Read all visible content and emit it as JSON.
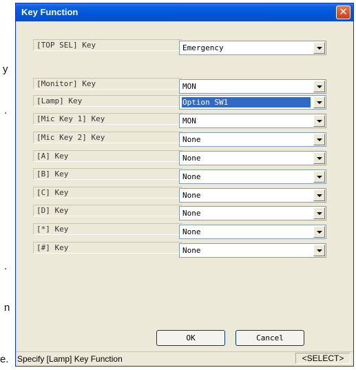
{
  "background_chars": [
    "y",
    ".",
    ".",
    "n",
    "e."
  ],
  "window": {
    "title": "Key Function",
    "close_glyph": "✕"
  },
  "rows": [
    {
      "label": "[TOP SEL] Key",
      "value": "Emergency"
    },
    {
      "label": "[Monitor] Key",
      "value": "MON"
    },
    {
      "label": "[Lamp] Key",
      "value": "Option SW1",
      "selected": true
    },
    {
      "label": "[Mic Key 1] Key",
      "value": "MON"
    },
    {
      "label": "[Mic Key 2] Key",
      "value": "None"
    },
    {
      "label": "[A] Key",
      "value": "None"
    },
    {
      "label": "[B] Key",
      "value": "None"
    },
    {
      "label": "[C] Key",
      "value": "None"
    },
    {
      "label": "[D] Key",
      "value": "None"
    },
    {
      "label": "[*] Key",
      "value": "None"
    },
    {
      "label": "[#] Key",
      "value": "None"
    }
  ],
  "buttons": {
    "ok": "OK",
    "cancel": "Cancel"
  },
  "status": {
    "text": "Specify [Lamp] Key Function",
    "mode": "<SELECT>"
  },
  "colors": {
    "title_bar": "#0356d8",
    "selection": "#316ac5",
    "dialog_bg": "#ece9d8"
  }
}
